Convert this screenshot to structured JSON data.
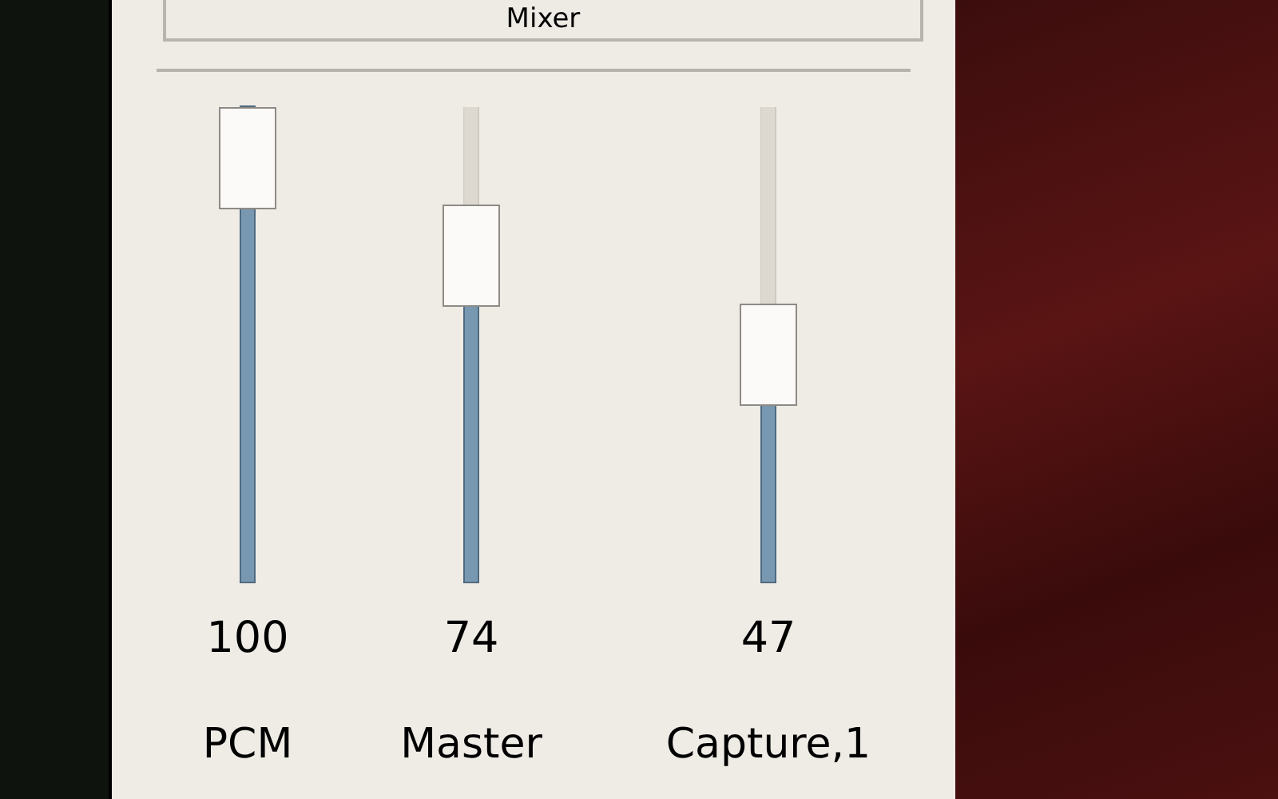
{
  "mixer_button": {
    "label": "Mixer"
  },
  "channels": [
    {
      "name": "PCM",
      "level": 1.0,
      "reading": "100"
    },
    {
      "name": "Master",
      "level": 0.74,
      "reading": "74"
    },
    {
      "name": "Capture,1",
      "level": 0.47,
      "reading": "47"
    }
  ]
}
